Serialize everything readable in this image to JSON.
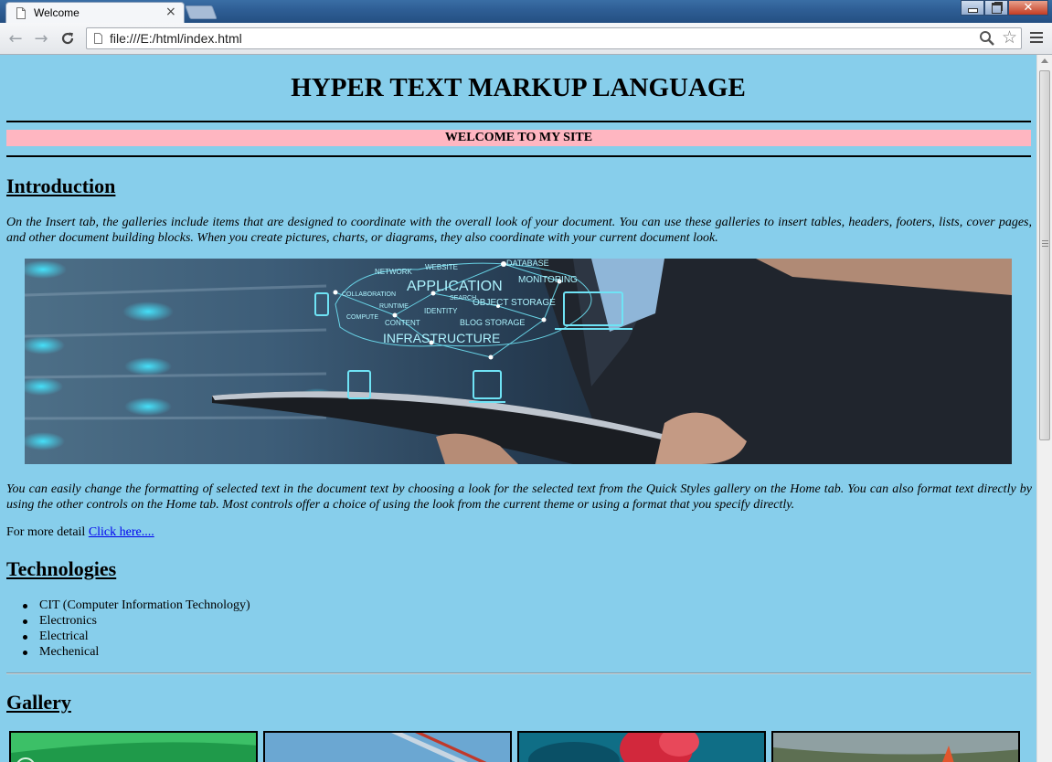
{
  "browser": {
    "tab_title": "Welcome",
    "tab_close": "×",
    "url": "file:///E:/html/index.html",
    "icons": {
      "back": "back-arrow-icon",
      "forward": "forward-arrow-icon",
      "reload": "reload-icon",
      "page": "page-icon",
      "search": "search-icon",
      "bookmark": "star-icon",
      "menu": "menu-icon"
    }
  },
  "page": {
    "title": "HYPER TEXT MARKUP LANGUAGE",
    "banner": "WELCOME TO MY SITE",
    "banner_color": "#ffb6c1",
    "background_color": "#87ceeb",
    "intro": {
      "heading": "Introduction",
      "paragraph": "On the Insert tab, the galleries include items that are designed to coordinate with the overall look of your document. You can use these galleries to insert tables, headers, footers, lists, cover pages, and other document building blocks. When you create pictures, charts, or diagrams, they also coordinate with your current document look.",
      "paragraph2": "You can easily change the formatting of selected text in the document text by choosing a look for the selected text from the Quick Styles gallery on the Home tab. You can also format text directly by using the other controls on the Home tab. Most controls offer a choice of using the look from the current theme or using a format that you specify directly.",
      "more_prefix": "For more detail",
      "more_link": "Click here....",
      "image_labels": [
        "NETWORK",
        "WEBSITE",
        "DATABASE",
        "APPLICATION",
        "MONITORING",
        "COLLABORATION",
        "SEARCH",
        "OBJECT STORAGE",
        "RUNTIME",
        "IDENTITY",
        "COMPUTE",
        "CONTENT",
        "BLOG STORAGE",
        "INFRASTRUCTURE"
      ]
    },
    "technologies": {
      "heading": "Technologies",
      "items": [
        "CIT (Computer Information Technology)",
        "Electronics",
        "Electrical",
        "Mechenical"
      ]
    },
    "gallery": {
      "heading": "Gallery"
    }
  }
}
